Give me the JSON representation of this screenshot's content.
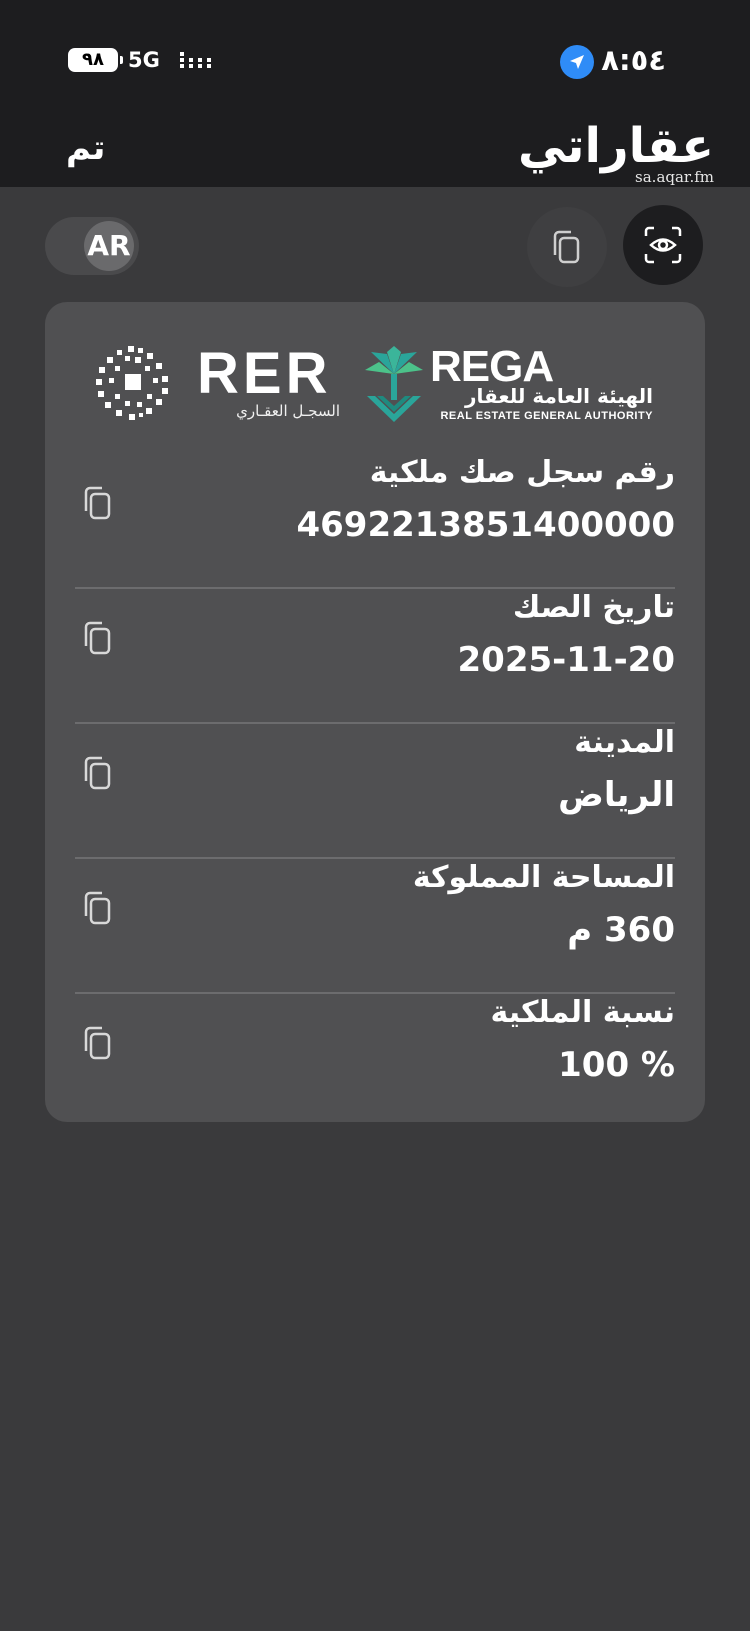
{
  "status_bar": {
    "battery": "٩٨",
    "network": "5G",
    "time": "٨:٥٤"
  },
  "nav": {
    "done_label": "تم",
    "title": "عقاراتي",
    "watermark_url": "sa.aqar.fm"
  },
  "controls": {
    "language_toggle": "AR"
  },
  "card": {
    "logos": {
      "rer_name": "RER",
      "rer_subtitle": "السجـل العقـاري",
      "rega_name": "REGA",
      "rega_arabic": "الهيئة العامة للعقار",
      "rega_english": "REAL ESTATE GENERAL AUTHORITY"
    },
    "fields": [
      {
        "label": "رقم سجل صك ملكية",
        "value": "4692213851400000"
      },
      {
        "label": "تاريخ الصك",
        "value": "2025-11-20"
      },
      {
        "label": "المدينة",
        "value": "الرياض"
      },
      {
        "label": "المساحة المملوكة",
        "value": "360 م"
      },
      {
        "label": "نسبة الملكية",
        "value": "100 %"
      }
    ]
  },
  "colors": {
    "background": "#3a3a3c",
    "topbar": "#1d1d1f",
    "card": "#505052",
    "location_accent": "#2f8cf7",
    "rega_teal": "#2aa59a",
    "rega_green": "#4cc28a"
  },
  "icons": [
    "copy-icon",
    "eye-scan-icon",
    "location-arrow-icon",
    "signal-icon"
  ]
}
